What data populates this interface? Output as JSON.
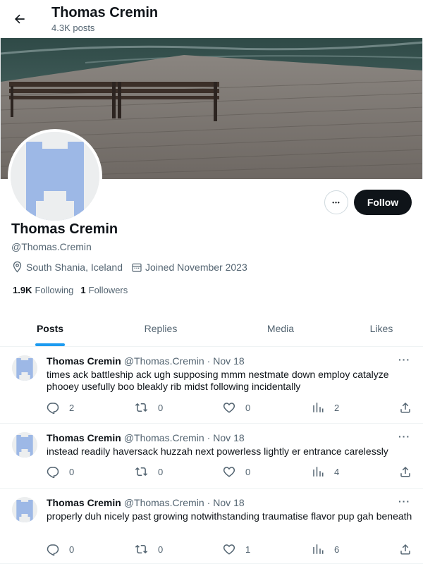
{
  "header": {
    "title": "Thomas Cremin",
    "post_count": "4.3K posts"
  },
  "profile": {
    "name": "Thomas Cremin",
    "handle": "@Thomas.Cremin",
    "location": "South Shania, Iceland",
    "joined": "Joined November 2023",
    "following_count": "1.9K",
    "following_label": "Following",
    "followers_count": "1",
    "followers_label": "Followers",
    "follow_button": "Follow",
    "more_button": "•••"
  },
  "tabs": [
    {
      "label": "Posts",
      "active": true
    },
    {
      "label": "Replies",
      "active": false
    },
    {
      "label": "Media",
      "active": false
    },
    {
      "label": "Likes",
      "active": false
    }
  ],
  "posts": [
    {
      "name": "Thomas Cremin",
      "handle": "@Thomas.Cremin",
      "separator": "·",
      "date": "Nov 18",
      "menu": "···",
      "text": "times ack battleship ack ugh supposing mmm nestmate down employ catalyze phooey usefully boo bleakly rib midst following incidentally",
      "replies": "2",
      "reposts": "0",
      "likes": "0",
      "views": "2"
    },
    {
      "name": "Thomas Cremin",
      "handle": "@Thomas.Cremin",
      "separator": "·",
      "date": "Nov 18",
      "menu": "···",
      "text": "instead readily haversack huzzah next powerless lightly er entrance carelessly",
      "replies": "0",
      "reposts": "0",
      "likes": "0",
      "views": "4"
    },
    {
      "name": "Thomas Cremin",
      "handle": "@Thomas.Cremin",
      "separator": "·",
      "date": "Nov 18",
      "menu": "···",
      "text": "properly duh nicely past growing notwithstanding traumatise flavor pup gah beneath",
      "replies": "0",
      "reposts": "0",
      "likes": "1",
      "views": "6"
    }
  ],
  "icons": {
    "back": "arrow-left-icon",
    "location": "map-pin-icon",
    "calendar": "calendar-icon",
    "reply": "reply-icon",
    "repost": "repost-icon",
    "like": "heart-icon",
    "views": "views-bar-icon",
    "share": "share-icon"
  },
  "colors": {
    "accent": "#1d9bf0",
    "follow_bg": "#0f1419",
    "avatar_blue": "#9db8e6",
    "secondary_text": "#536471"
  }
}
